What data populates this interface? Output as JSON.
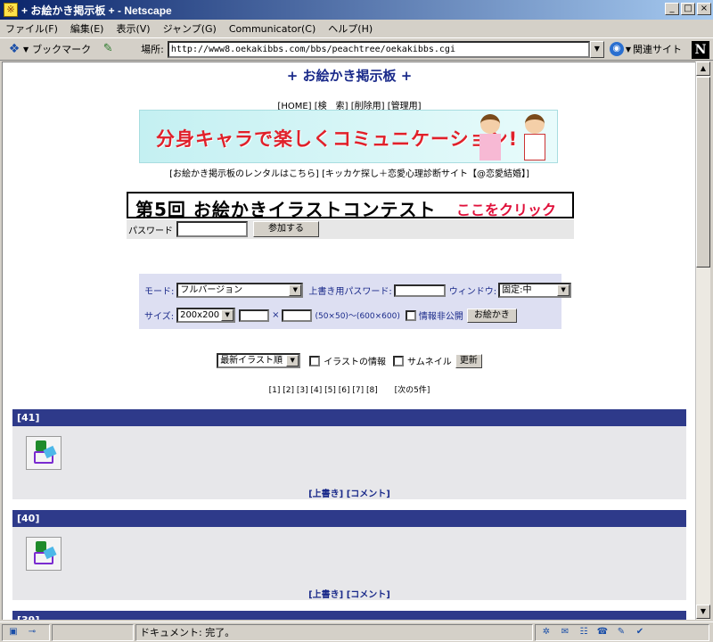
{
  "window": {
    "title": "+ お絵かき掲示板 + - Netscape",
    "minimize": "_",
    "maximize": "□",
    "close": "×"
  },
  "menu": [
    "ファイル(F)",
    "編集(E)",
    "表示(V)",
    "ジャンプ(G)",
    "Communicator(C)",
    "ヘルプ(H)"
  ],
  "toolbar": {
    "bookmark_label": "ブックマーク",
    "location_label": "場所:",
    "url": "http://www8.oekakibbs.com/bbs/peachtree/oekakibbs.cgi",
    "related_label": "関連サイト",
    "logo": "N"
  },
  "page": {
    "title": "+ お絵かき掲示板 +",
    "nav": [
      "[HOME]",
      "[検　索]",
      "[削除用]",
      "[管理用]"
    ],
    "banner1_text": "分身キャラで楽しくコミュニケーション!",
    "sponsor_links": [
      "[お絵かき掲示板のレンタルはこちら]",
      "[キッカケ探し＋恋愛心理診断サイト【@恋愛結婚】]"
    ],
    "contest_text": "第5回  お絵かきイラストコンテスト",
    "contest_click": "ここをクリック",
    "password_label": "パスワード",
    "join_button": "参加する"
  },
  "form": {
    "mode_label": "モード:",
    "mode_value": "フルバージョン",
    "overwrite_pw_label": "上書き用パスワード:",
    "window_label": "ウィンドウ:",
    "window_value": "固定:中",
    "size_label": "サイズ:",
    "size_value": "200x200",
    "x_sep": "×",
    "size_range": "(50×50)～(600×600)",
    "hide_info_label": "情報非公開",
    "draw_button": "お絵かき"
  },
  "sort": {
    "order_value": "最新イラスト順",
    "info_label": "イラストの情報",
    "thumb_label": "サムネイル",
    "refresh_button": "更新"
  },
  "pager": {
    "pages": [
      "[1]",
      "[2]",
      "[3]",
      "[4]",
      "[5]",
      "[6]",
      "[7]",
      "[8]"
    ],
    "next": "[次の5件]"
  },
  "posts": [
    {
      "id": "[41]",
      "overwrite": "[上書き]",
      "comment": "[コメント]"
    },
    {
      "id": "[40]",
      "overwrite": "[上書き]",
      "comment": "[コメント]"
    },
    {
      "id": "[39]"
    }
  ],
  "status": {
    "text": "ドキュメント: 完了。"
  },
  "icons": [
    "app-icon",
    "bookmark-icon",
    "location-icon",
    "globe-icon",
    "netscape-logo-icon",
    "scroll-up-icon",
    "scroll-down-icon",
    "dropdown-arrow-icon",
    "lock-icon",
    "connection-icon"
  ],
  "colors": {
    "title_blue": "#1a2a8a",
    "post_header": "#2e3a8a",
    "form_bg": "#dddff2",
    "banner_red": "#e0202a"
  }
}
